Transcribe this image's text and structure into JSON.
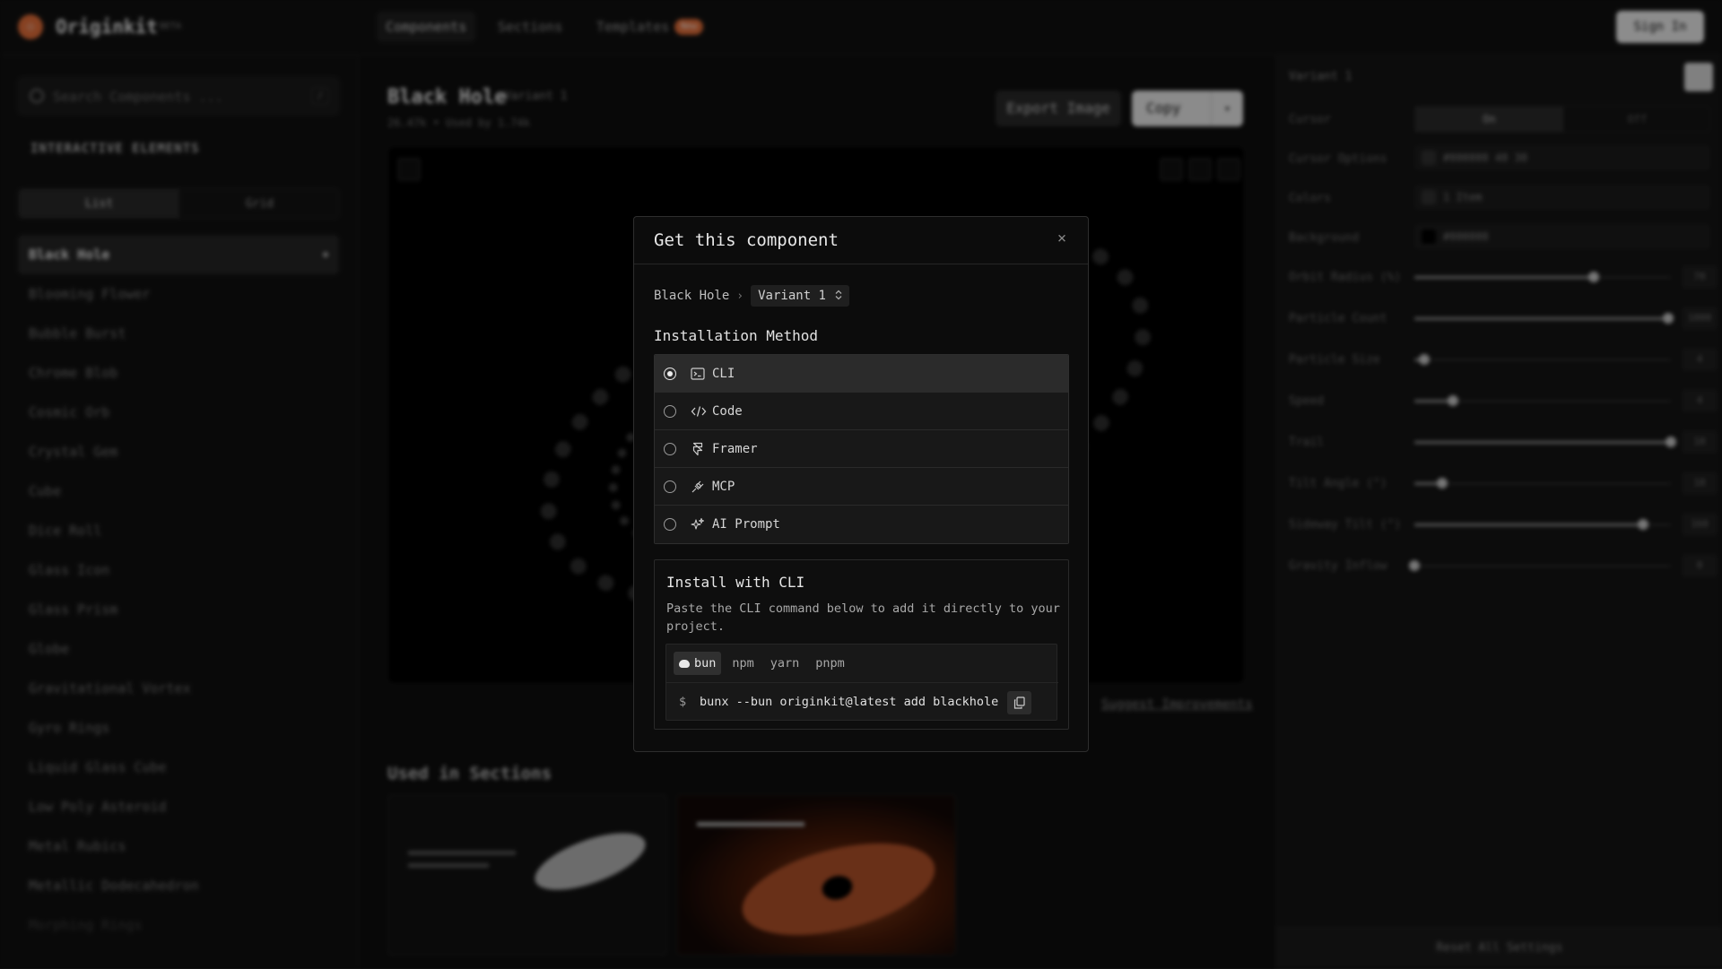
{
  "header": {
    "brand": "Originkit",
    "beta": "BETA",
    "tabs": [
      "Components",
      "Sections",
      "Templates"
    ],
    "new_badge": "New",
    "sign_in": "Sign In"
  },
  "sidebar": {
    "search_placeholder": "Search Components ...",
    "search_shortcut": "/",
    "section_title": "INTERACTIVE ELEMENTS",
    "view_list": "List",
    "view_grid": "Grid",
    "items": [
      "Black Hole",
      "Blooming Flower",
      "Bubble Burst",
      "Chrome Blob",
      "Cosmic Orb",
      "Crystal Gem",
      "Cube",
      "Dice Roll",
      "Glass Icon",
      "Glass Prism",
      "Globe",
      "Gravitational Vortex",
      "Gyro Rings",
      "Liquid Glass Cube",
      "Low Poly Asteroid",
      "Metal Rubics",
      "Metallic Dodecahedron",
      "Morphing Rings"
    ]
  },
  "main": {
    "title": "Black Hole",
    "variant": "Variant 1",
    "stats": "26.47k • Used by 1.74k",
    "export_label": "Export Image",
    "copy_label": "Copy",
    "support_link": "Suggest Improvements",
    "used_in_title": "Used in Sections"
  },
  "right_panel": {
    "variant": "Variant 1",
    "cursor_label": "Cursor",
    "cursor_on": "On",
    "cursor_off": "Off",
    "cursor_options_label": "Cursor Options",
    "cursor_options_value": "#000000  40  30",
    "colors_label": "Colors",
    "colors_value": "1 Item",
    "background_label": "Background",
    "background_value": "#000000",
    "sliders": [
      {
        "label": "Orbit Radius (%)",
        "value": "70",
        "level": 0.7
      },
      {
        "label": "Particle Count",
        "value": "1000",
        "level": 0.99
      },
      {
        "label": "Particle Size",
        "value": "4",
        "level": 0.04
      },
      {
        "label": "Speed",
        "value": "4",
        "level": 0.15
      },
      {
        "label": "Trail",
        "value": "10",
        "level": 1.0
      },
      {
        "label": "Tilt Angle (°)",
        "value": "10",
        "level": 0.11
      },
      {
        "label": "Sideway Tilt (°)",
        "value": "160",
        "level": 0.89
      },
      {
        "label": "Gravity Inflow",
        "value": "0",
        "level": 0.0
      }
    ],
    "reset_label": "Reset All Settings"
  },
  "modal": {
    "title": "Get this component",
    "close_glyph": "×",
    "breadcrumb_component": "Black Hole",
    "breadcrumb_sep": "›",
    "variant_label": "Variant 1",
    "variant_chevron": "⌃⌄",
    "install_method_label": "Installation Method",
    "methods": [
      {
        "label": "CLI",
        "icon": "terminal-icon",
        "selected": true
      },
      {
        "label": "Code",
        "icon": "code-icon",
        "selected": false
      },
      {
        "label": "Framer",
        "icon": "framer-icon",
        "selected": false
      },
      {
        "label": "MCP",
        "icon": "mcp-icon",
        "selected": false
      },
      {
        "label": "AI Prompt",
        "icon": "sparkles-icon",
        "selected": false
      }
    ],
    "cli_title": "Install with CLI",
    "cli_description": "Paste the CLI command below to add it directly to your project.",
    "package_managers": [
      "bun",
      "npm",
      "yarn",
      "pnpm"
    ],
    "active_package_manager": "bun",
    "prompt_symbol": "$",
    "command": "bunx --bun originkit@latest add blackhole"
  }
}
